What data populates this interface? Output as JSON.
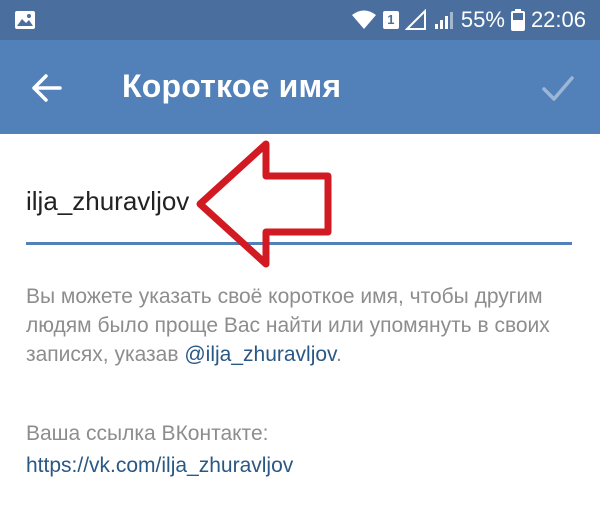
{
  "status_bar": {
    "sim_slot": "1",
    "battery_percent": "55%",
    "time": "22:06",
    "icons": [
      "image-icon",
      "wifi-icon",
      "sim-icon",
      "signal-icon",
      "signal-icon",
      "battery-icon"
    ]
  },
  "header": {
    "title": "Короткое имя",
    "back_icon": "arrow-left-icon",
    "confirm_icon": "check-icon"
  },
  "form": {
    "shortname_value": "ilja_zhuravljov"
  },
  "hint": {
    "text": "Вы можете указать своё короткое имя, чтобы другим людям было проще Вас найти или упомянуть в своих записях, указав ",
    "mention": "@ilja_zhuravljov",
    "suffix": "."
  },
  "vk_link": {
    "label": "Ваша ссылка ВКонтакте:",
    "url": "https://vk.com/ilja_zhuravljov"
  },
  "colors": {
    "status_bar": "#4a6f9e",
    "app_bar": "#5181b8",
    "link": "#2a5885",
    "hint_text": "#8d8d8d",
    "annotation_arrow": "#d21a22"
  }
}
